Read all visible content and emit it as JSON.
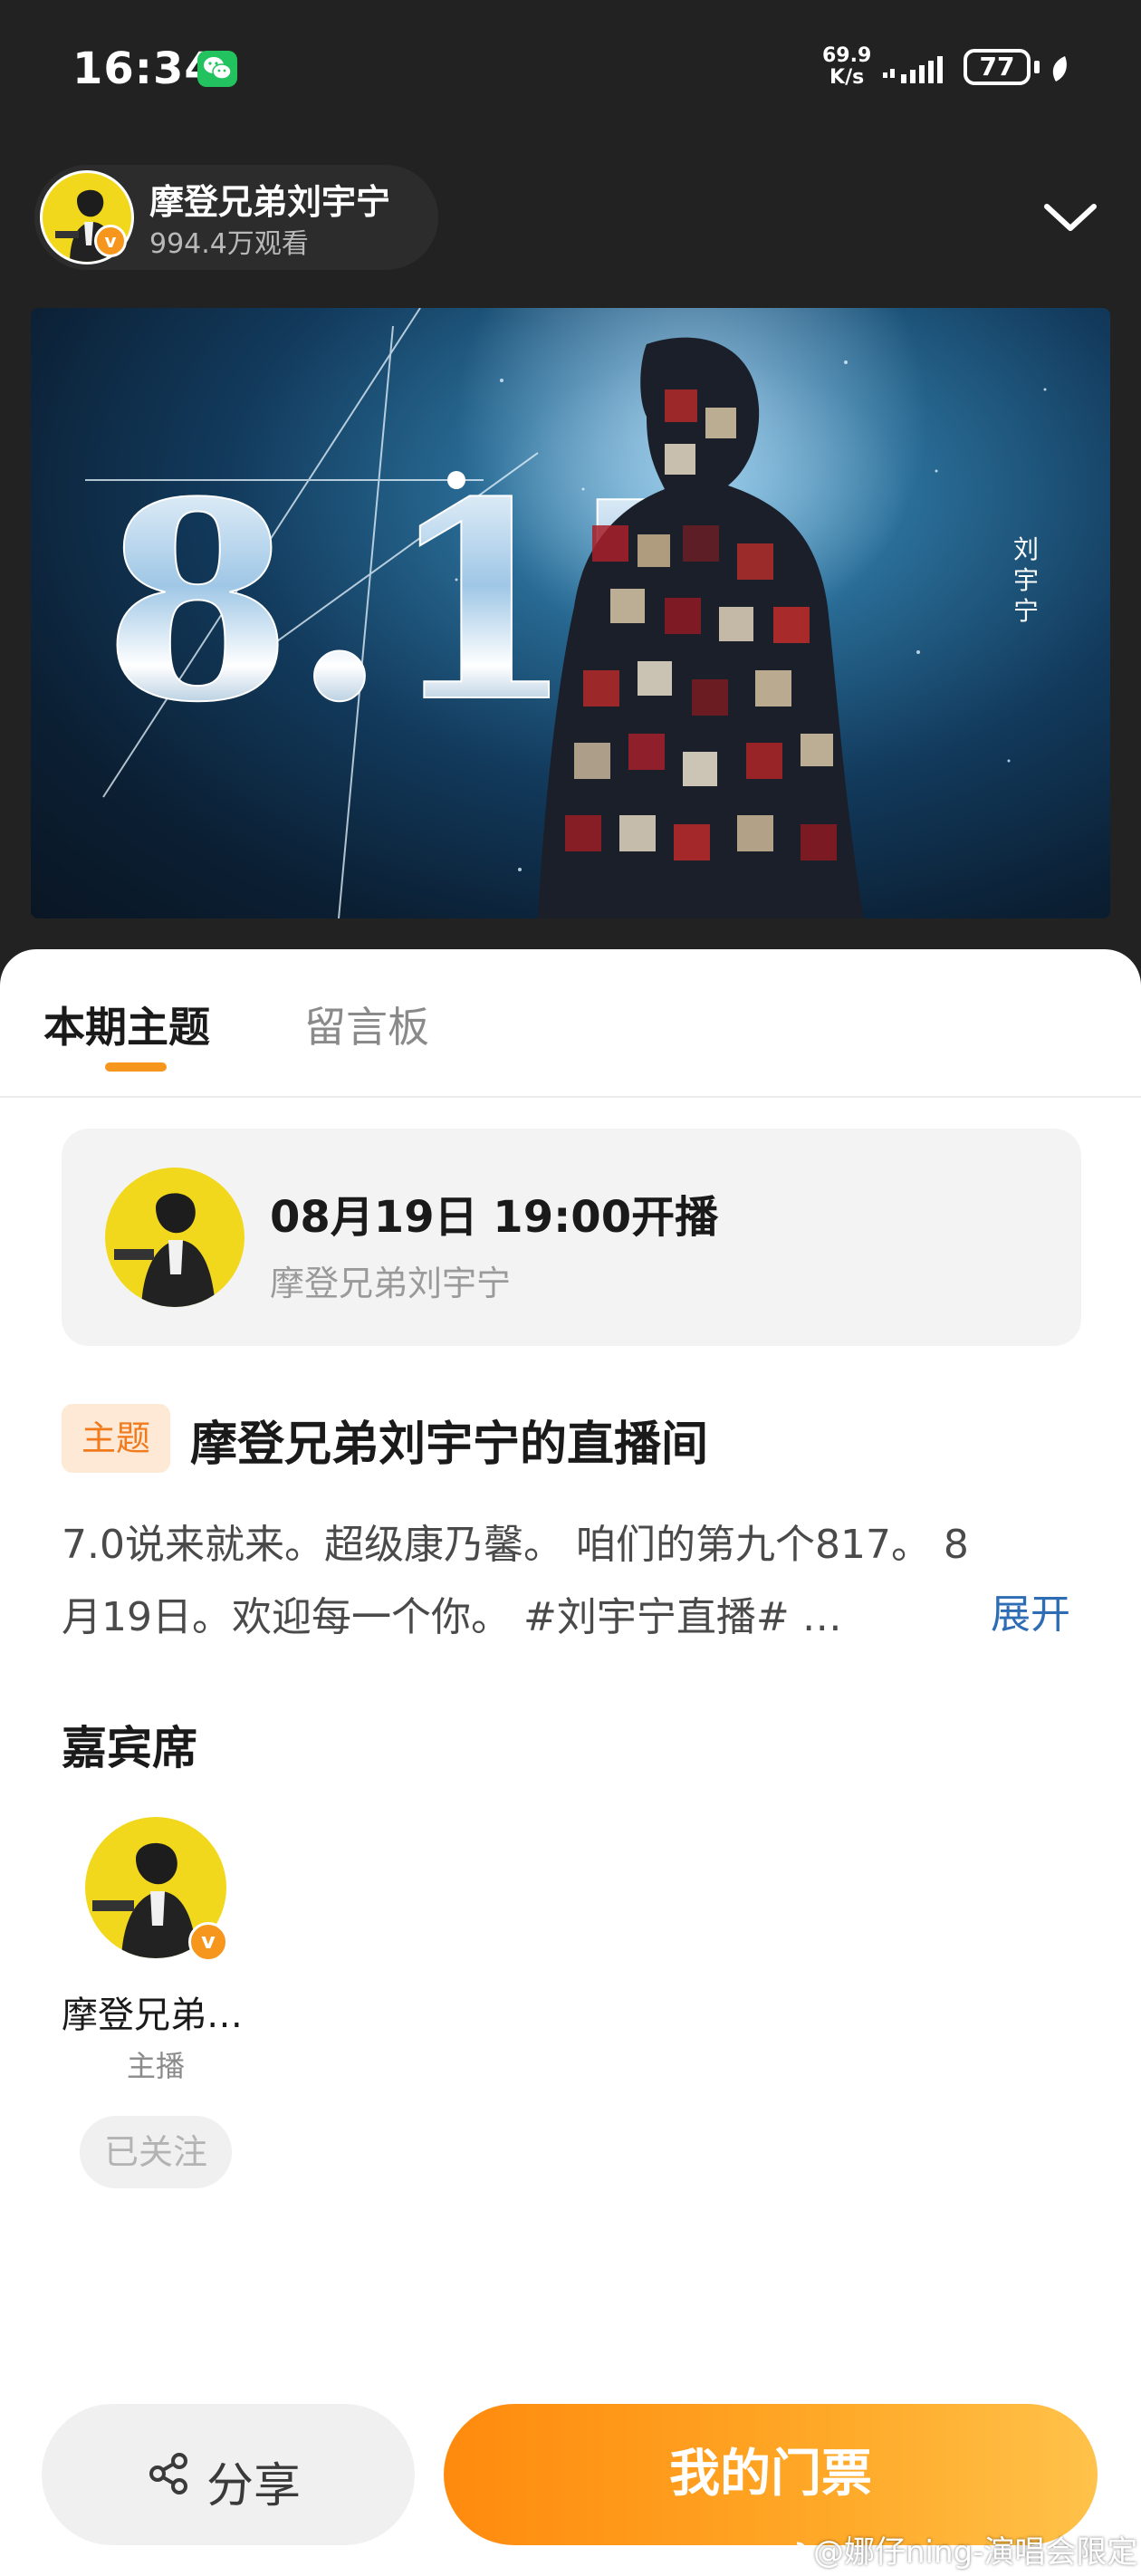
{
  "status_bar": {
    "time": "16:34",
    "net_speed_value": "69.9",
    "net_speed_unit": "K/s",
    "battery": "77"
  },
  "header": {
    "host_name": "摩登兄弟刘宇宁",
    "views": "994.4万观看"
  },
  "banner": {
    "poster_number": "8.17",
    "poster_name": "刘宇宁"
  },
  "tabs": [
    {
      "label": "本期主题",
      "active": true
    },
    {
      "label": "留言板",
      "active": false
    }
  ],
  "schedule": {
    "time": "08月19日 19:00开播",
    "host": "摩登兄弟刘宇宁"
  },
  "topic": {
    "tag": "主题",
    "title": "摩登兄弟刘宇宁的直播间",
    "description_line1": "7.0说来就来。超级康乃馨。 咱们的第九个817。 8",
    "description_line2": "月19日。欢迎每一个你。 #刘宇宁直播# …",
    "expand_label": "展开"
  },
  "guests": {
    "heading": "嘉宾席",
    "items": [
      {
        "name": "摩登兄弟…",
        "role": "主播",
        "follow_label": "已关注"
      }
    ]
  },
  "actions": {
    "share_label": "分享",
    "ticket_label": "我的门票"
  },
  "watermark": "@娜仔ning-演唱会限定",
  "colors": {
    "accent_orange": "#f7961d",
    "link_blue": "#2e6db4",
    "verified_badge": "#f6961c",
    "avatar_yellow": "#f2d81c"
  }
}
